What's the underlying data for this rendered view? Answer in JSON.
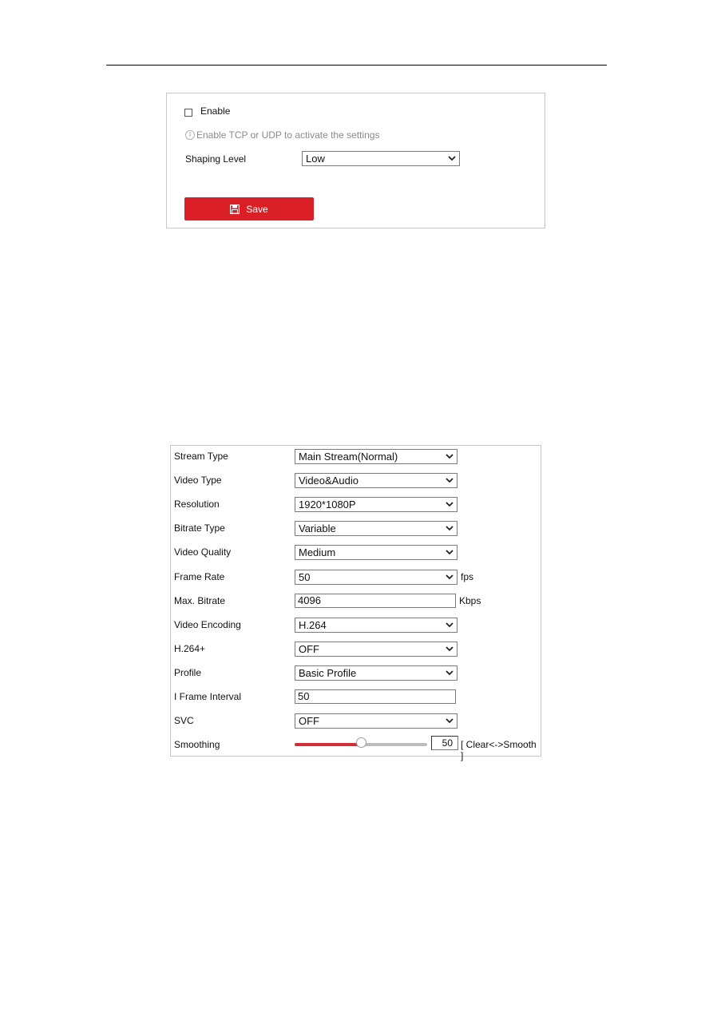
{
  "traffic_shaping": {
    "enable_label": "Enable",
    "enable_checked": false,
    "hint": "Enable TCP or UDP to activate the settings",
    "shaping_level_label": "Shaping Level",
    "shaping_level_value": "Low",
    "save_label": "Save",
    "accent_color": "#da1f26"
  },
  "video_settings": {
    "rows": [
      {
        "label": "Stream Type",
        "type": "select",
        "value": "Main Stream(Normal)"
      },
      {
        "label": "Video Type",
        "type": "select",
        "value": "Video&Audio"
      },
      {
        "label": "Resolution",
        "type": "select",
        "value": "1920*1080P"
      },
      {
        "label": "Bitrate Type",
        "type": "select",
        "value": "Variable"
      },
      {
        "label": "Video Quality",
        "type": "select",
        "value": "Medium"
      },
      {
        "label": "Frame Rate",
        "type": "select",
        "value": "50",
        "unit": "fps"
      },
      {
        "label": "Max. Bitrate",
        "type": "input",
        "value": "4096",
        "unit": "Kbps"
      },
      {
        "label": "Video Encoding",
        "type": "select",
        "value": "H.264"
      },
      {
        "label": "H.264+",
        "type": "select",
        "value": "OFF"
      },
      {
        "label": "Profile",
        "type": "select",
        "value": "Basic Profile"
      },
      {
        "label": "I Frame Interval",
        "type": "input",
        "value": "50"
      },
      {
        "label": "SVC",
        "type": "select",
        "value": "OFF"
      }
    ],
    "smoothing": {
      "label": "Smoothing",
      "value": "50",
      "fraction": 0.5,
      "hint": "[ Clear<->Smooth ]"
    }
  }
}
